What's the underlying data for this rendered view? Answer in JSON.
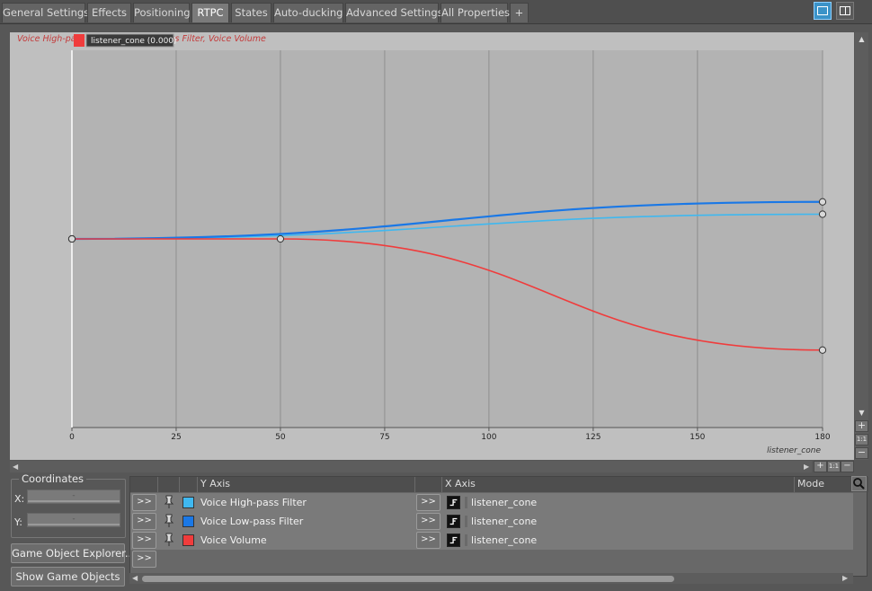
{
  "tabs": [
    {
      "label": "General Settings",
      "active": false
    },
    {
      "label": "Effects",
      "active": false
    },
    {
      "label": "Positioning",
      "active": false
    },
    {
      "label": "RTPC",
      "active": true
    },
    {
      "label": "States",
      "active": false
    },
    {
      "label": "Auto-ducking",
      "active": false
    },
    {
      "label": "Advanced Settings",
      "active": false
    },
    {
      "label": "All Properties",
      "active": false
    },
    {
      "label": "+",
      "active": false
    }
  ],
  "graph": {
    "legend_text": "Voice High-pass Filter, Voice Low-pass Filter, Voice Volume",
    "tooltip_label": "listener_cone (0.000)",
    "x_axis_name": "listener_cone",
    "x_ticks": [
      "0",
      "25",
      "50",
      "75",
      "100",
      "125",
      "150",
      "180"
    ]
  },
  "coordinates": {
    "title": "Coordinates",
    "x_label": "X:",
    "y_label": "Y:",
    "x_value": "-",
    "y_value": "-"
  },
  "buttons": {
    "explorer": "Game Object Explorer...",
    "show_objects": "Show Game Objects",
    "expand": ">>"
  },
  "rtpc_table": {
    "headers": {
      "y_axis": "Y Axis",
      "x_axis": "X Axis",
      "mode": "Mode"
    },
    "rows": [
      {
        "y_axis": "Voice High-pass Filter",
        "color": "#3fb8f0",
        "x_axis": "listener_cone"
      },
      {
        "y_axis": "Voice Low-pass Filter",
        "color": "#1a78e6",
        "x_axis": "listener_cone"
      },
      {
        "y_axis": "Voice Volume",
        "color": "#f03c3c",
        "x_axis": "listener_cone"
      }
    ]
  },
  "colors": {
    "high_pass": "#3fb8f0",
    "low_pass": "#1a78e6",
    "volume": "#f03c3c",
    "active_tab": "#7a7a7a",
    "graph_bg": "#bfbfbf"
  },
  "chart_data": {
    "type": "line",
    "xlabel": "listener_cone",
    "xlim": [
      0,
      180
    ],
    "x_ticks": [
      0,
      25,
      50,
      75,
      100,
      125,
      150,
      180
    ],
    "series": [
      {
        "name": "Voice High-pass Filter",
        "color": "#3fb8f0",
        "points": [
          [
            0,
            0
          ],
          [
            180,
            0.1
          ]
        ]
      },
      {
        "name": "Voice Low-pass Filter",
        "color": "#1a78e6",
        "points": [
          [
            0,
            0
          ],
          [
            180,
            0.15
          ]
        ]
      },
      {
        "name": "Voice Volume",
        "color": "#f03c3c",
        "points": [
          [
            0,
            0
          ],
          [
            50,
            0
          ],
          [
            180,
            -0.45
          ]
        ]
      }
    ]
  }
}
